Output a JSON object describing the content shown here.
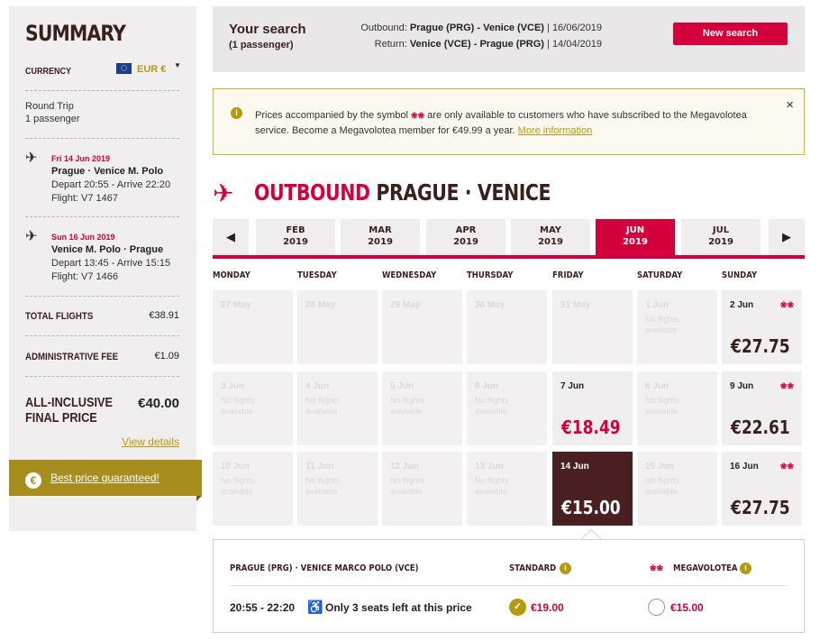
{
  "sidebar": {
    "title": "SUMMARY",
    "currency_label": "CURRENCY",
    "currency_value": "EUR €",
    "trip_type": "Round Trip",
    "passengers": "1 passenger",
    "outbound": {
      "date": "Fri 14 Jun 2019",
      "route": "Prague · Venice M. Polo",
      "times": "Depart 20:55 - Arrive 22:20",
      "flight": "Flight: V7 1467"
    },
    "return": {
      "date": "Sun 16 Jun 2019",
      "route": "Venice M. Polo · Prague",
      "times": "Depart 13:45 - Arrive 15:15",
      "flight": "Flight: V7 1466"
    },
    "total_flights_label": "TOTAL FLIGHTS",
    "total_flights_value": "€38.91",
    "admin_fee_label": "ADMINISTRATIVE FEE",
    "admin_fee_value": "€1.09",
    "final_label": "ALL-INCLUSIVE FINAL PRICE",
    "final_value": "€40.00",
    "view_details": "View details",
    "guarantee": "Best price guaranteed!",
    "guarantee_icon": "€"
  },
  "search": {
    "title": "Your search",
    "subtitle": "(1 passenger)",
    "outbound_label": "Outbound:",
    "outbound_route": "Prague (PRG) - Venice (VCE)",
    "outbound_date": " | 16/06/2019",
    "return_label": "Return:",
    "return_route": "Venice (VCE) - Prague (PRG)",
    "return_date": " | 14/04/2019",
    "new_search": "New search"
  },
  "notice": {
    "text_before": "Prices accompanied by the symbol ",
    "text_after": " are only available to customers who have subscribed to the Megavolotea service. Become a Megavolotea member for €49.99 a year. ",
    "link": "More information",
    "close": "×"
  },
  "outbound": {
    "word": "OUTBOUND",
    "route": " PRAGUE · VENICE"
  },
  "months": [
    {
      "m": "FEB",
      "y": "2019"
    },
    {
      "m": "MAR",
      "y": "2019"
    },
    {
      "m": "APR",
      "y": "2019"
    },
    {
      "m": "MAY",
      "y": "2019"
    },
    {
      "m": "JUN",
      "y": "2019"
    },
    {
      "m": "JUL",
      "y": "2019"
    }
  ],
  "nav": {
    "prev": "◀",
    "next": "▶"
  },
  "days_of_week": [
    "MONDAY",
    "TUESDAY",
    "WEDNESDAY",
    "THURSDAY",
    "FRIDAY",
    "SATURDAY",
    "SUNDAY"
  ],
  "no_flights": "No flights available",
  "calendar": [
    [
      {
        "d": "27 May"
      },
      {
        "d": "28 May"
      },
      {
        "d": "29 May"
      },
      {
        "d": "30 May"
      },
      {
        "d": "31 May"
      },
      {
        "d": "1 Jun",
        "nf": true
      },
      {
        "d": "2 Jun",
        "price": "€27.75",
        "mv": true
      }
    ],
    [
      {
        "d": "3 Jun",
        "nf": true
      },
      {
        "d": "4 Jun",
        "nf": true
      },
      {
        "d": "5 Jun",
        "nf": true
      },
      {
        "d": "6 Jun",
        "nf": true
      },
      {
        "d": "7 Jun",
        "price": "€18.49",
        "red": true
      },
      {
        "d": "8 Jun",
        "nf": true
      },
      {
        "d": "9 Jun",
        "price": "€22.61",
        "mv": true
      }
    ],
    [
      {
        "d": "10 Jun",
        "nf": true
      },
      {
        "d": "11 Jun",
        "nf": true
      },
      {
        "d": "12 Jun",
        "nf": true
      },
      {
        "d": "13 Jun",
        "nf": true
      },
      {
        "d": "14 Jun",
        "price": "€15.00",
        "selected": true
      },
      {
        "d": "15 Jun",
        "nf": true
      },
      {
        "d": "16 Jun",
        "price": "€27.75",
        "mv": true
      }
    ]
  ],
  "mv_symbol": "❀❀",
  "fare": {
    "route": "PRAGUE (PRG) · VENICE MARCO POLO (VCE)",
    "standard_label": "STANDARD",
    "megavolotea_label": "MEGAVOLOTEA",
    "info_icon": "i",
    "time": "20:55 - 22:20",
    "seats": "Only 3 seats left at this price",
    "standard_price": "€19.00",
    "megavolotea_price": "€15.00"
  },
  "colors": {
    "brand_red": "#d4003b",
    "brand_gold": "#b59a10",
    "dark_brown": "#3a1f1f",
    "selected_bg": "#4a1f22"
  }
}
